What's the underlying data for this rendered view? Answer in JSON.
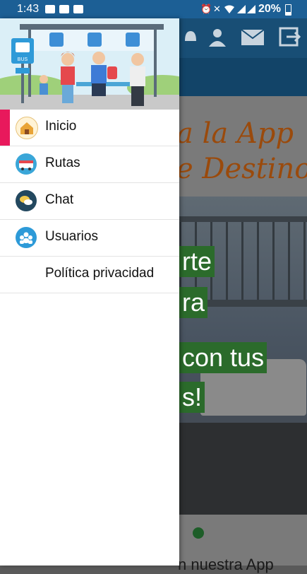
{
  "status_bar": {
    "time": "1:43",
    "battery_percent": "20%"
  },
  "background_app": {
    "welcome_line1": "a la App",
    "welcome_line2": "e Destino",
    "slide_lines": [
      "rte",
      "ra",
      "con tus",
      "s!"
    ],
    "bottom_text": "n nuestra App"
  },
  "drawer": {
    "header_sign": "BUS",
    "items": [
      {
        "label": "Inicio",
        "icon": "home-icon",
        "active": true
      },
      {
        "label": "Rutas",
        "icon": "bus-route-icon",
        "active": false
      },
      {
        "label": "Chat",
        "icon": "chat-icon",
        "active": false
      },
      {
        "label": "Usuarios",
        "icon": "users-icon",
        "active": false
      },
      {
        "label": "Política privacidad",
        "icon": "",
        "active": false
      }
    ]
  },
  "colors": {
    "status_bar": "#1c5f95",
    "toolbar": "#184e75",
    "active_indicator": "#e8195c",
    "welcome_text": "#9a4a0c"
  }
}
